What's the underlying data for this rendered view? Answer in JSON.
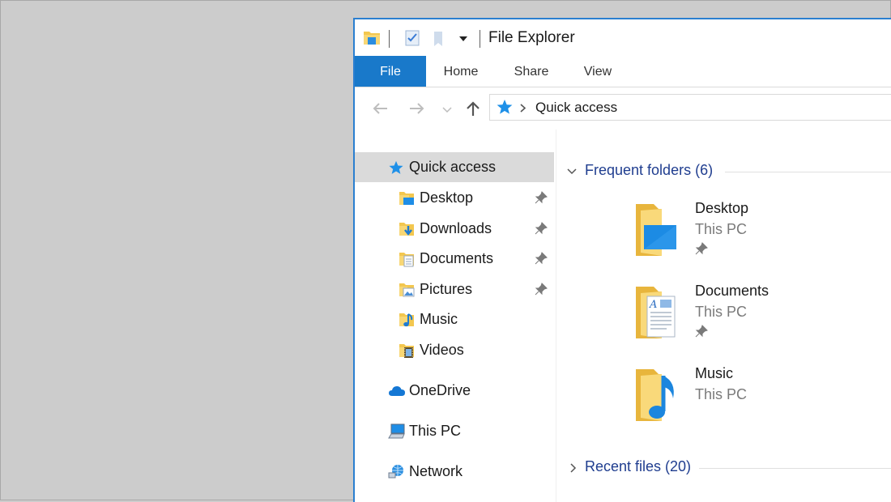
{
  "window": {
    "title": "File Explorer"
  },
  "ribbon": {
    "tabs": [
      "File",
      "Home",
      "Share",
      "View"
    ]
  },
  "address_bar": {
    "path": "Quick access"
  },
  "nav_pane": {
    "quick_access": "Quick access",
    "pinned": [
      {
        "label": "Desktop",
        "icon": "desktop-folder-icon",
        "pinned": true
      },
      {
        "label": "Downloads",
        "icon": "downloads-folder-icon",
        "pinned": true
      },
      {
        "label": "Documents",
        "icon": "documents-folder-icon",
        "pinned": true
      },
      {
        "label": "Pictures",
        "icon": "pictures-folder-icon",
        "pinned": true
      },
      {
        "label": "Music",
        "icon": "music-folder-icon",
        "pinned": false
      },
      {
        "label": "Videos",
        "icon": "videos-folder-icon",
        "pinned": false
      }
    ],
    "onedrive": "OneDrive",
    "this_pc": "This PC",
    "network": "Network"
  },
  "content": {
    "frequent_folders": "Frequent folders (6)",
    "recent_files": "Recent files (20)",
    "folders": [
      {
        "name": "Desktop",
        "location": "This PC",
        "pinned": true
      },
      {
        "name": "Documents",
        "location": "This PC",
        "pinned": true
      },
      {
        "name": "Music",
        "location": "This PC",
        "pinned": false
      }
    ]
  },
  "colors": {
    "accent": "#1979ca",
    "window_border": "#2b7fd0",
    "group_header": "#1f3d8f",
    "selection": "#dadada",
    "desktop_bg": "#cccccc"
  }
}
